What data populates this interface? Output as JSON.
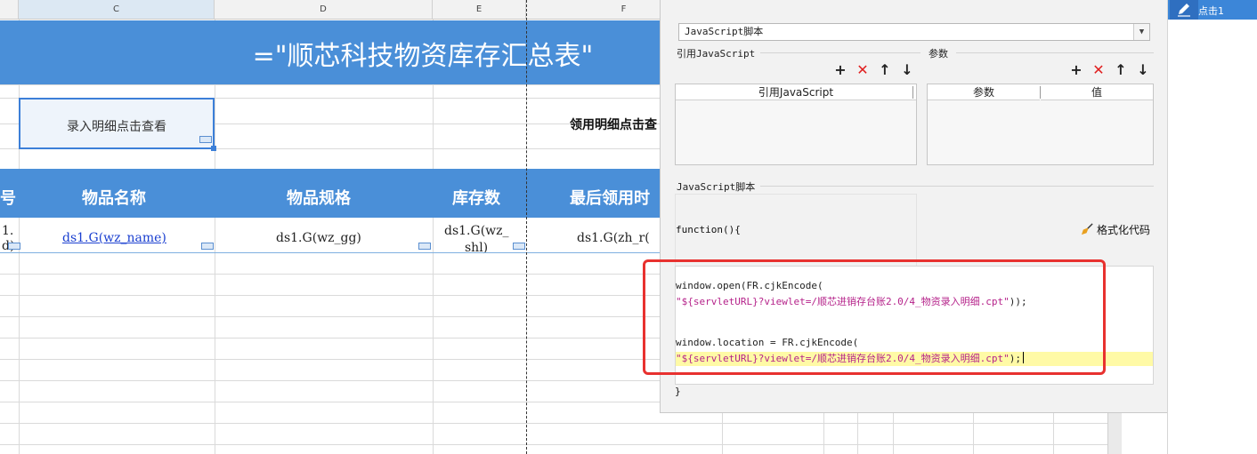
{
  "sheet": {
    "columns": [
      "C",
      "D",
      "E",
      "F"
    ],
    "title": "=\"顺芯科技物资库存汇总表\"",
    "entry_button_label": "录入明细点击查看",
    "use_detail_label": "领用明细点击查",
    "headers": [
      "号",
      "物品名称",
      "物品规格",
      "库存数",
      "最后领用时"
    ],
    "row": {
      "col_a_line1": "1.",
      "col_a_line2": "d)",
      "wz_name": "ds1.G(wz_name)",
      "wz_gg": "ds1.G(wz_gg)",
      "wz_shl_line1": "ds1.G(wz_",
      "wz_shl_line2": "shl)",
      "zh_partial": "ds1.G(zh_r("
    }
  },
  "panel": {
    "script_type": "JavaScript脚本",
    "ref_js_label": "引用JavaScript",
    "params_label": "参数",
    "ref_js_col": "引用JavaScript",
    "param_col": "参数",
    "value_col": "值",
    "script_section_label": "JavaScript脚本",
    "fn_open": "function(){",
    "format_code": "格式化代码",
    "code": {
      "l1": "window.open(FR.cjkEncode(",
      "l2": "\"${servletURL}?viewlet=/顺芯进销存台账2.0/4_物资录入明细.cpt\"",
      "l2_tail": "));",
      "l3": "window.location = FR.cjkEncode(",
      "l4": "\"${servletURL}?viewlet=/顺芯进销存台账2.0/4_物资录入明细.cpt\"",
      "l4_tail": ");"
    },
    "fn_close": "}"
  },
  "event_list": {
    "item": "点击1"
  },
  "colors": {
    "band_blue": "#4a8fd8",
    "highlight_red": "#e8312f",
    "event_blue": "#3c86d8"
  }
}
